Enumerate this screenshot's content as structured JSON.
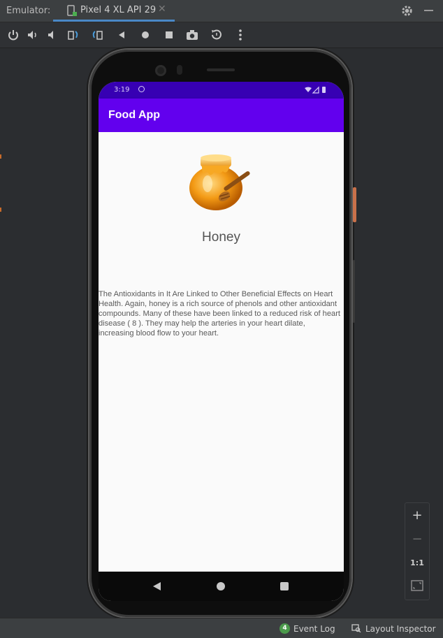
{
  "ide": {
    "panel_label": "Emulator:",
    "device_tab_label": "Pixel 4 XL API 29",
    "close_glyph": "✕"
  },
  "toolbar": {
    "icons": [
      "power-icon",
      "volume-up-icon",
      "volume-down-icon",
      "rotate-left-icon",
      "rotate-right-icon",
      "back-icon",
      "home-icon",
      "overview-icon",
      "screenshot-icon",
      "snapshot-icon",
      "more-icon"
    ]
  },
  "phone": {
    "status_time": "3:19",
    "app_title": "Food App",
    "food_name": "Honey",
    "food_description": "The Antioxidants in It Are Linked to Other Beneficial Effects on Heart Health. Again, honey is a rich source of phenols and other antioxidant compounds. Many of these have been linked to a reduced risk of heart disease ( 8 ). They may help the arteries in your heart dilate, increasing blood flow to your heart.",
    "colors": {
      "status_bar": "#3700b3",
      "app_bar": "#6200ee",
      "background": "#fafafa"
    }
  },
  "zoom": {
    "zoom_in": "+",
    "zoom_out": "−",
    "actual_size": "1:1"
  },
  "status_bar": {
    "event_log_count": "4",
    "event_log_label": "Event Log",
    "layout_inspector_label": "Layout Inspector"
  }
}
